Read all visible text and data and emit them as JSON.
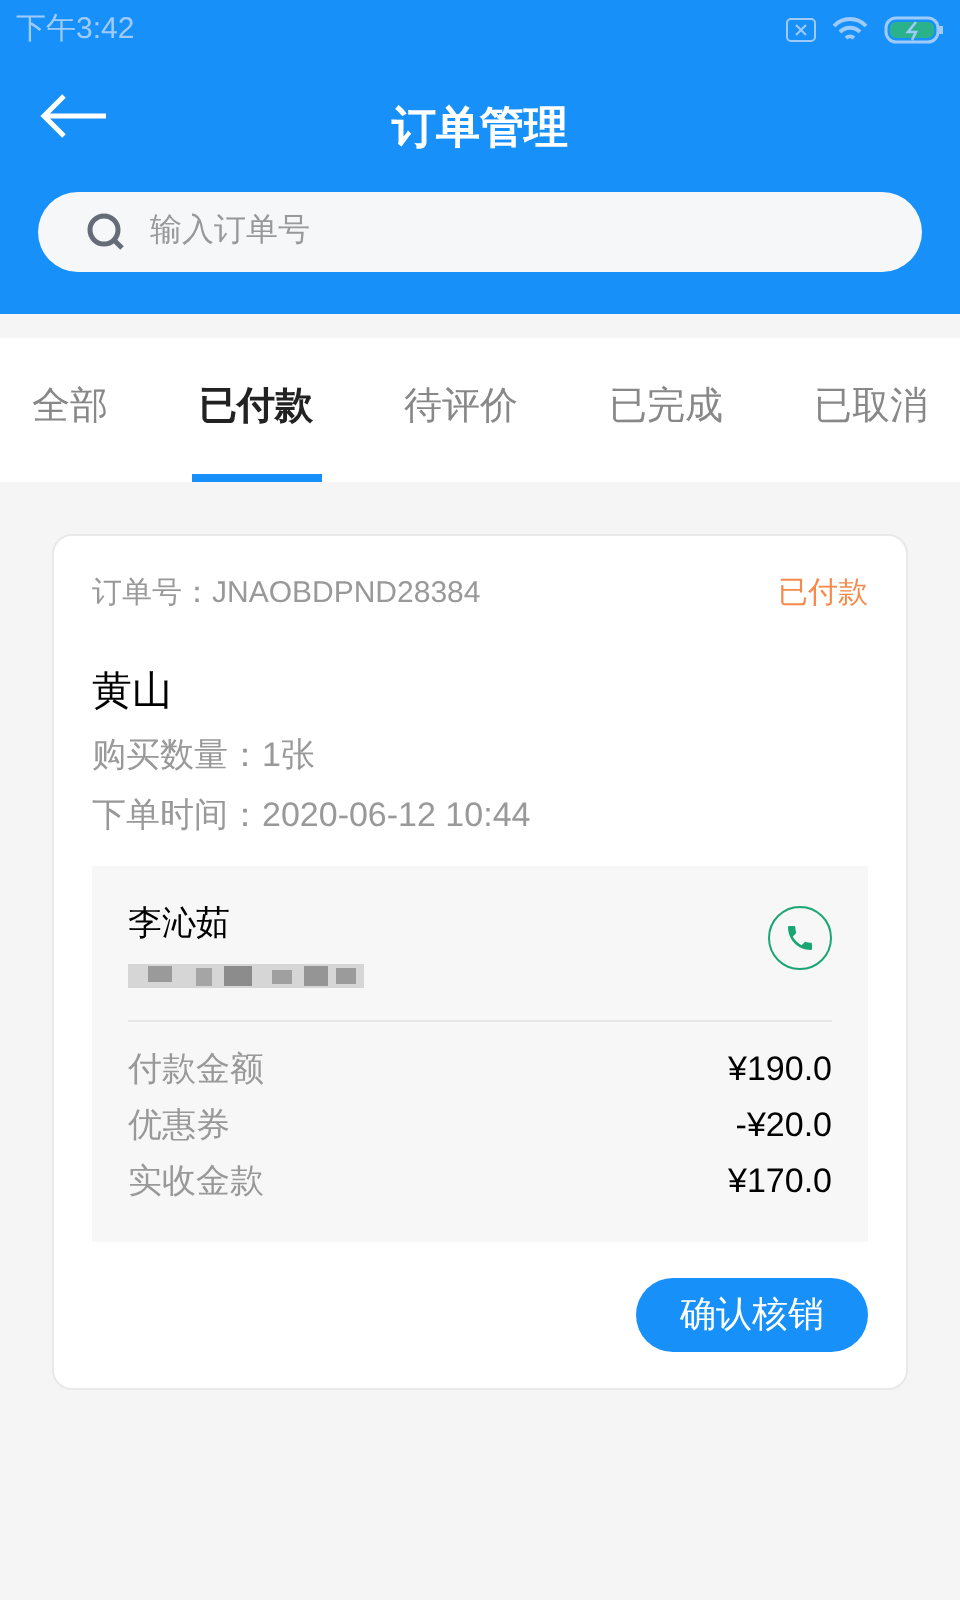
{
  "status_bar": {
    "time": "下午3:42"
  },
  "header": {
    "title": "订单管理"
  },
  "search": {
    "placeholder": "输入订单号"
  },
  "tabs": [
    {
      "label": "全部",
      "selected": false
    },
    {
      "label": "已付款",
      "selected": true
    },
    {
      "label": "待评价",
      "selected": false
    },
    {
      "label": "已完成",
      "selected": false
    },
    {
      "label": "已取消",
      "selected": false
    }
  ],
  "order": {
    "number": "订单号：JNAOBDPND28384",
    "status": "已付款",
    "name": "黄山",
    "quantity": "购买数量：1张",
    "time": "下单时间：2020-06-12 10:44",
    "customer": {
      "name": "李沁茹"
    },
    "amounts": [
      {
        "label": "付款金额",
        "value": "¥190.0"
      },
      {
        "label": "优惠券",
        "value": "-¥20.0"
      },
      {
        "label": "实收金款",
        "value": "¥170.0"
      }
    ],
    "button": "确认核销"
  }
}
